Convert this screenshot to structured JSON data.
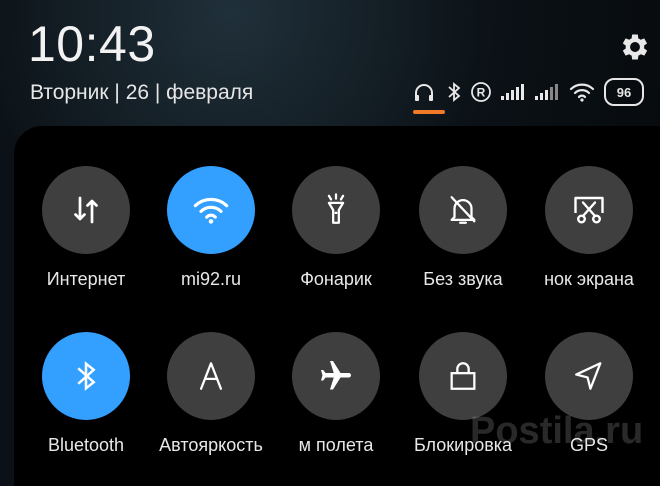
{
  "status_bar": {
    "time": "10:43",
    "date": "Вторник | 26 | февраля",
    "battery": "96",
    "icons": [
      "headphones-icon",
      "bluetooth-icon",
      "registered-icon",
      "signal-icon",
      "signal-icon",
      "wifi-icon",
      "battery-icon"
    ],
    "accent_color": "#f07a28"
  },
  "tiles": [
    {
      "label": "Интернет",
      "icon": "data-transfer-icon",
      "active": false
    },
    {
      "label": "mi92.ru",
      "icon": "wifi-icon",
      "active": true
    },
    {
      "label": "Фонарик",
      "icon": "flashlight-icon",
      "active": false
    },
    {
      "label": "Без звука",
      "icon": "bell-off-icon",
      "active": false
    },
    {
      "label": "нок экрана",
      "icon": "screenshot-icon",
      "active": false
    },
    {
      "label": "Bluetooth",
      "icon": "bluetooth-icon",
      "active": true
    },
    {
      "label": "Автояркость",
      "icon": "auto-brightness-icon",
      "active": false
    },
    {
      "label": "м полета",
      "icon": "airplane-icon",
      "active": false
    },
    {
      "label": "Блокировка",
      "icon": "lock-icon",
      "active": false
    },
    {
      "label": "GPS",
      "icon": "location-icon",
      "active": false
    }
  ],
  "colors": {
    "active_tile": "#33a0ff",
    "inactive_tile": "#3f3f3f",
    "panel_bg": "#000000"
  },
  "watermark": "Postila.ru"
}
